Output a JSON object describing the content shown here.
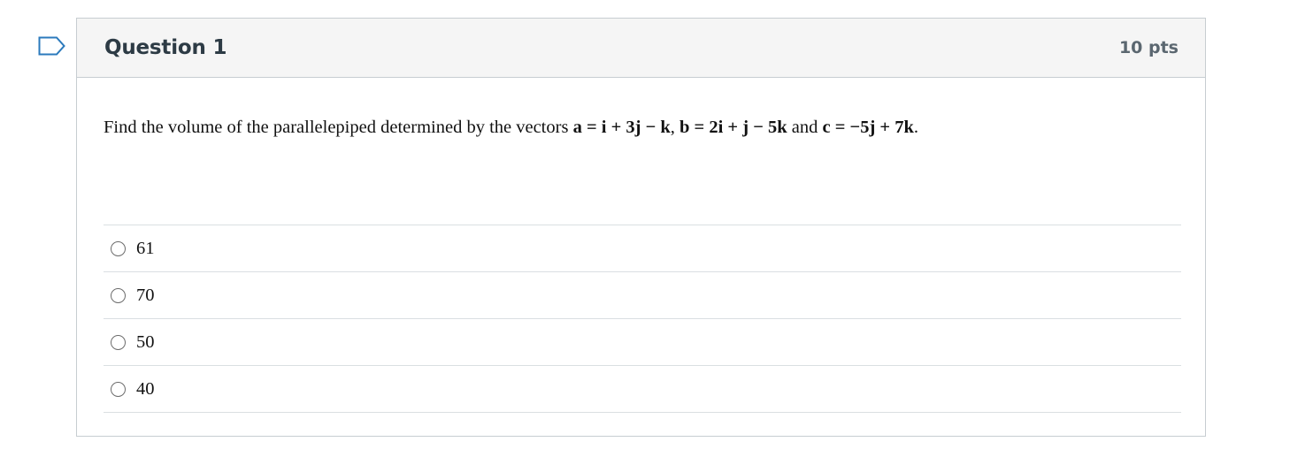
{
  "question": {
    "title": "Question 1",
    "points": "10 pts",
    "flag_icon": "bookmark-flag-icon",
    "text_parts": {
      "intro": "Find the volume of the parallelepiped determined by the vectors ",
      "vec_a": "a = i + 3j − k",
      "sep1": ", ",
      "vec_b": "b = 2i + j − 5k",
      "and": " and ",
      "vec_c": "c = −5j + 7k",
      "end": "."
    },
    "answers": [
      {
        "label": "61",
        "selected": false
      },
      {
        "label": "70",
        "selected": false
      },
      {
        "label": "50",
        "selected": false
      },
      {
        "label": "40",
        "selected": false
      }
    ]
  },
  "colors": {
    "header_bg": "#f5f5f5",
    "border": "#c7cdd1",
    "flag": "#2b7abc",
    "title": "#2d3b45"
  }
}
